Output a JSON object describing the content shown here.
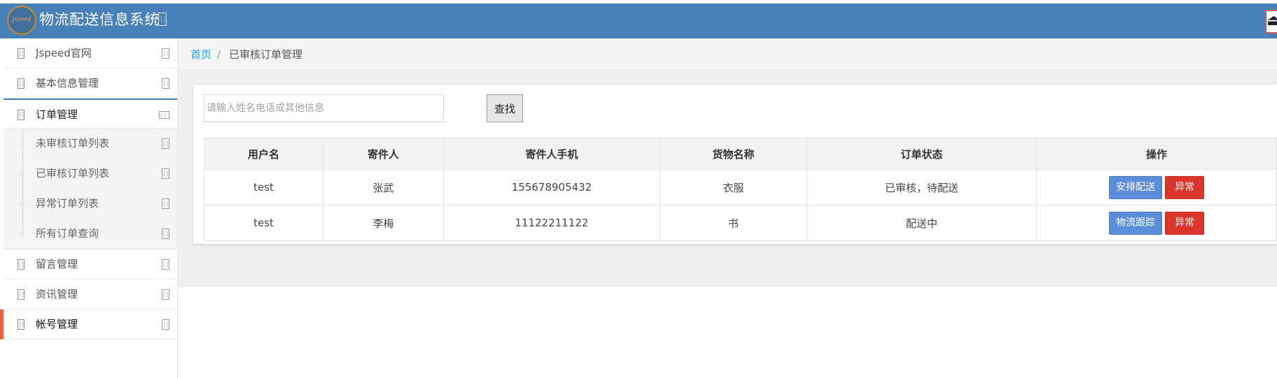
{
  "header": {
    "logo_text": "Jspeed",
    "title": "物流配送信息系统",
    "title_icon": "broken-image-icon",
    "exit_icon": "logout-icon"
  },
  "sidebar": {
    "items": [
      {
        "label": "Jspeed官网",
        "icon": "broken-image-icon"
      },
      {
        "label": "基本信息管理",
        "icon": "broken-image-icon"
      },
      {
        "label": "订单管理",
        "icon": "broken-image-icon",
        "expanded": true,
        "children": [
          {
            "label": "未审核订单列表"
          },
          {
            "label": "已审核订单列表"
          },
          {
            "label": "异常订单列表"
          },
          {
            "label": "所有订单查询"
          }
        ]
      },
      {
        "label": "留言管理",
        "icon": "broken-image-icon"
      },
      {
        "label": "资讯管理",
        "icon": "broken-image-icon"
      },
      {
        "label": "帐号管理",
        "icon": "broken-image-icon",
        "active": true
      }
    ]
  },
  "breadcrumb": {
    "home": "首页",
    "separator": "/",
    "current": "已审核订单管理"
  },
  "search": {
    "placeholder": "请输入姓名电话或其他信息",
    "value": "",
    "button": "查找"
  },
  "table": {
    "headers": [
      "用户名",
      "寄件人",
      "寄件人手机",
      "货物名称",
      "订单状态",
      "操作"
    ],
    "rows": [
      {
        "user": "test",
        "sender": "张武",
        "phone": "155678905432",
        "goods": "衣服",
        "status": "已审核，待配送",
        "action_primary": "安排配送",
        "action_danger": "异常"
      },
      {
        "user": "test",
        "sender": "李梅",
        "phone": "11122211122",
        "goods": "书",
        "status": "配送中",
        "action_primary": "物流跟踪",
        "action_danger": "异常"
      }
    ]
  },
  "colors": {
    "header_bg": "#4781b7",
    "link": "#1e9fff",
    "primary_button": "#5c8ddb",
    "danger_button": "#d9352a",
    "active_marker": "#e8603c"
  }
}
